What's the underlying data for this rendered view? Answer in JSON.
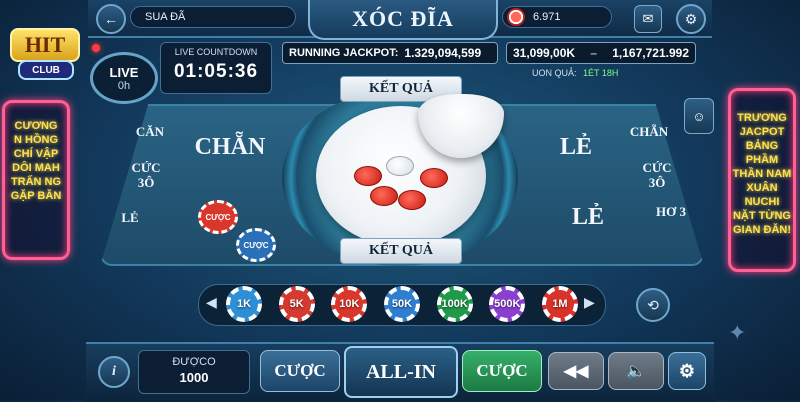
{
  "header": {
    "back_icon": "arrow-left-icon",
    "user_name": "SUA ĐÃ",
    "game_title": "XÓC ĐĨA",
    "balance": "6.971",
    "mail_icon": "mail-icon",
    "settings_icon": "gear-icon"
  },
  "live": {
    "badge": "LIVE",
    "sub": "0h",
    "countdown_label": "LIVE COUNTDOWN",
    "countdown_value": "01:05:36"
  },
  "jackpot": {
    "label": "RUNNING JACKPOT:",
    "value": "1.329,094,599",
    "second": "31,099,00K",
    "third": "1,167,721.992",
    "win_label": "UON QUẢ:",
    "win_value": "1ÉT 18H"
  },
  "table": {
    "left_main": "CHẴN",
    "right_main_top": "LẺ",
    "right_main_bottom": "LẺ",
    "left_cells": [
      "CĂN",
      "CỨC 3Ô",
      "LẺ"
    ],
    "right_cells": [
      "CHẴN",
      "CỨC 3Ô",
      "HƠ 3"
    ],
    "result_top": "KẾT QUẢ",
    "result_bottom": "KẾT QUẢ",
    "placed_bet_1": "CƯỢC",
    "placed_bet_2": "CƯỢC"
  },
  "chips": [
    {
      "label": "1K",
      "color": "#2f8fd6"
    },
    {
      "label": "5K",
      "color": "#d43a2f"
    },
    {
      "label": "10K",
      "color": "#d9372c"
    },
    {
      "label": "50K",
      "color": "#2f7fd1"
    },
    {
      "label": "100K",
      "color": "#1f9a4a"
    },
    {
      "label": "500K",
      "color": "#8a3fd1"
    },
    {
      "label": "1M",
      "color": "#d8322a"
    }
  ],
  "bottom": {
    "info_icon": "info-icon",
    "won_label": "ĐƯỢCO",
    "won_value": "1000",
    "bet_left": "CƯỢC",
    "all_in": "ALL-IN",
    "bet_right": "CƯỢC",
    "rewind_icon": "rewind-icon",
    "sound_icon": "speaker-icon",
    "settings_icon": "gear-icon"
  },
  "left_sign": {
    "logo_text": "HIT",
    "logo_sub": "CLUB",
    "lines": [
      "CƯƠNG",
      "N HỒNG",
      "CHÍ VẬP",
      "DÔI MAH",
      "TRẤN NG",
      "GẶP BĂN"
    ]
  },
  "right_sign": {
    "lines": [
      "TRƯƠNG",
      "JACPOT",
      "BẢNG PHẦM",
      "THẦN NAM",
      "XUÂN NUCHI",
      "NẶT TỪNG",
      "GIAN ĐĂN!"
    ]
  },
  "colors": {
    "accent": "#7fb4da",
    "neon_pink": "#ff5f92",
    "neon_yellow": "#ffe14d",
    "green_button": "#2f9d5a"
  }
}
